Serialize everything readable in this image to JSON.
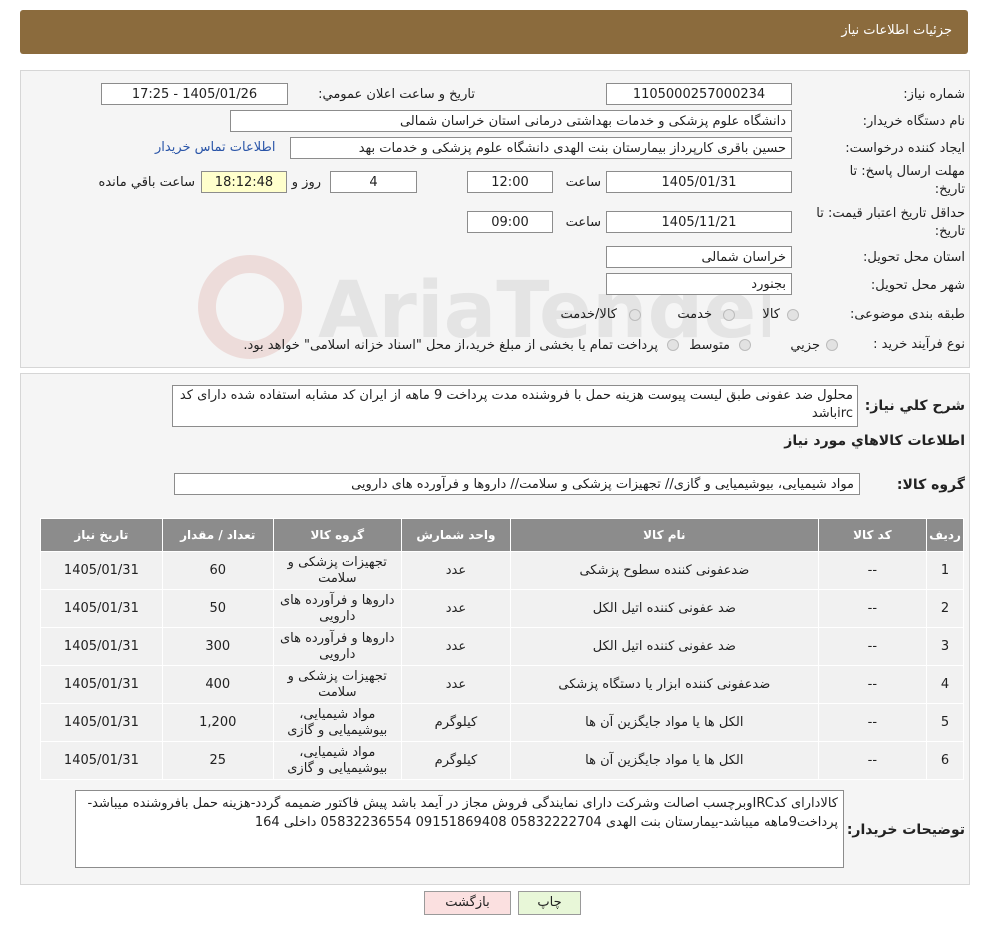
{
  "header": {
    "title": "جزئیات اطلاعات نیاز"
  },
  "form": {
    "need_number_label": "شماره نیاز:",
    "need_number": "1105000257000234",
    "announce_label": "تاریخ و ساعت اعلان عمومي:",
    "announce_value": "1405/01/26 - 17:25",
    "buyer_org_label": "نام دستگاه خريدار:",
    "buyer_org": "دانشگاه علوم پزشکی و خدمات بهداشتی درمانی استان خراسان شمالی",
    "creator_label": "ايجاد کننده درخواست:",
    "creator": "حسین باقری کارپرداز بیمارستان بنت الهدی دانشگاه علوم پزشکی و خدمات بهد",
    "contact_link": "اطلاعات تماس خريدار",
    "deadline_label_1": "مهلت ارسال پاسخ: تا",
    "deadline_label_2": "تاريخ:",
    "deadline_date": "1405/01/31",
    "time_label": "ساعت",
    "deadline_time": "12:00",
    "days": "4",
    "days_label": "روز و",
    "remaining": "18:12:48",
    "remaining_label": "ساعت باقي مانده",
    "validity_label_1": "حداقل تاريخ اعتبار قيمت: تا",
    "validity_label_2": "تاريخ:",
    "validity_date": "1405/11/21",
    "validity_time": "09:00",
    "province_label": "استان محل تحويل:",
    "province": "خراسان شمالی",
    "city_label": "شهر محل تحويل:",
    "city": "بجنورد",
    "category_label": "طبقه بندی موضوعی:",
    "category_options": [
      "کالا",
      "خدمت",
      "کالا/خدمت"
    ],
    "process_label": "نوع فرآيند خريد :",
    "process_options": [
      "جزيي",
      "متوسط"
    ],
    "process_note": "پرداخت تمام يا بخشی از مبلغ خريد،از محل \"اسناد خزانه اسلامی\" خواهد بود."
  },
  "description": {
    "label": "شرح كلي نياز:",
    "text": "محلول ضد عفونی طبق لیست پیوست هزینه حمل با فروشنده مدت پرداخت 9 ماهه از ایران کد مشابه استفاده شده دارای کد ircباشد"
  },
  "goods": {
    "section_title": "اطلاعات كالاهاي مورد نياز",
    "group_label": "گروه کالا:",
    "group_value": "مواد شیمیایی، بیوشیمیایی و  گازی// تجهیزات پزشکی و سلامت// داروها و فرآورده های دارویی"
  },
  "table": {
    "headers": [
      "رديف",
      "کد کالا",
      "نام کالا",
      "واحد شمارش",
      "گروه کالا",
      "تعداد / مقدار",
      "تاريخ نياز"
    ],
    "rows": [
      [
        "1",
        "--",
        "ضدعفونی کننده سطوح پزشکی",
        "عدد",
        "تجهیزات پزشکی و سلامت",
        "60",
        "1405/01/31"
      ],
      [
        "2",
        "--",
        "ضد عفونی کننده اتیل الکل",
        "عدد",
        "داروها و فرآورده های دارویی",
        "50",
        "1405/01/31"
      ],
      [
        "3",
        "--",
        "ضد عفونی کننده اتیل الکل",
        "عدد",
        "داروها و فرآورده های دارویی",
        "300",
        "1405/01/31"
      ],
      [
        "4",
        "--",
        "ضدعفونی کننده ابزار یا دستگاه پزشکی",
        "عدد",
        "تجهیزات پزشکی و سلامت",
        "400",
        "1405/01/31"
      ],
      [
        "5",
        "--",
        "الکل ها یا مواد جایگزین آن ها",
        "کیلوگرم",
        "مواد شیمیایی، بیوشیمیایی و گازی",
        "1,200",
        "1405/01/31"
      ],
      [
        "6",
        "--",
        "الکل ها یا مواد جایگزین آن ها",
        "کیلوگرم",
        "مواد شیمیایی، بیوشیمیایی و گازی",
        "25",
        "1405/01/31"
      ]
    ]
  },
  "buyer_notes": {
    "label": "توضيحات خريدار:",
    "text": "کالادارای کدIRCوبرچسب اصالت وشرکت دارای نمایندگی فروش مجاز در آیمد باشد پیش فاکتور ضمیمه گردد-هزینه حمل بافروشنده میباشد-پرداخت9ماهه میباشد-بیمارستان بنت الهدی 05832222704 09151869408 05832236554  داخلی 164"
  },
  "buttons": {
    "print": "چاپ",
    "back": "بازگشت"
  },
  "watermark": {
    "text": "AriaTender.neT"
  },
  "colors": {
    "header": "#8b6b3d",
    "link": "#2a55a8",
    "table_header": "#8c8c8c",
    "back_button": "#fbe0e0",
    "print_button": "#e8f7d8"
  }
}
